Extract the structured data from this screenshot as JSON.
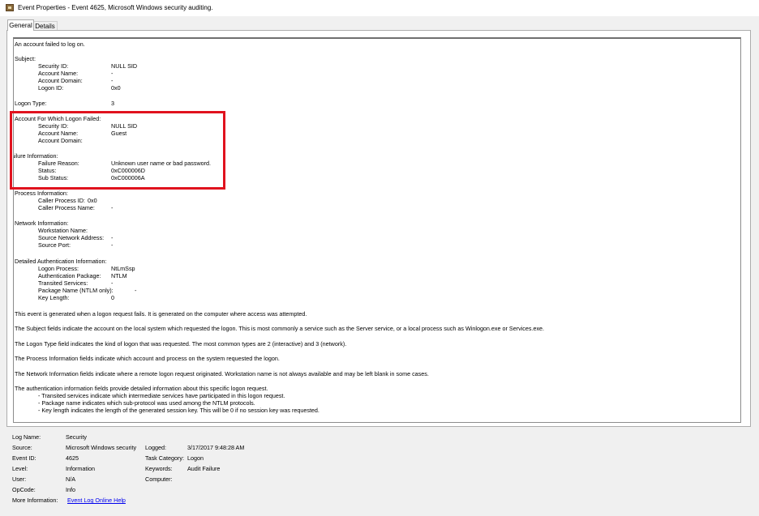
{
  "window": {
    "title": "Event Properties - Event 4625, Microsoft Windows security auditing."
  },
  "tabs": [
    {
      "label": "General"
    },
    {
      "label": "Details"
    }
  ],
  "description": {
    "intro": "An account failed to log on.",
    "subject": {
      "header": "Subject:",
      "fields": [
        {
          "label": "Security ID:",
          "value": "NULL SID"
        },
        {
          "label": "Account Name:",
          "value": "-"
        },
        {
          "label": "Account Domain:",
          "value": "-"
        },
        {
          "label": "Logon ID:",
          "value": "0x0"
        }
      ]
    },
    "logon_type": {
      "label": "Logon Type:",
      "value": "3"
    },
    "account_failed": {
      "header": "Account For Which Logon Failed:",
      "fields": [
        {
          "label": "Security ID:",
          "value": "NULL SID"
        },
        {
          "label": "Account Name:",
          "value": "Guest"
        },
        {
          "label": "Account Domain:",
          "value": ""
        }
      ]
    },
    "failure_info": {
      "header": "ailure Information:",
      "fields": [
        {
          "label": "Failure Reason:",
          "value": "Unknown user name or bad password."
        },
        {
          "label": "Status:",
          "value": "0xC000006D"
        },
        {
          "label": "Sub Status:",
          "value": "0xC000006A"
        }
      ]
    },
    "process_info": {
      "header": "Process Information:",
      "fields": [
        {
          "label": "Caller Process ID:",
          "value": "0x0"
        },
        {
          "label": "Caller Process Name:",
          "value": "-"
        }
      ]
    },
    "network_info": {
      "header": "Network Information:",
      "fields": [
        {
          "label": "Workstation Name:",
          "value": ""
        },
        {
          "label": "Source Network Address:",
          "value": "-"
        },
        {
          "label": "Source Port:",
          "value": "-"
        }
      ]
    },
    "auth_info": {
      "header": "Detailed Authentication Information:",
      "fields": [
        {
          "label": "Logon Process:",
          "value": "NtLmSsp"
        },
        {
          "label": "Authentication Package:",
          "value": "NTLM"
        },
        {
          "label": "Transited Services:",
          "value": "-"
        },
        {
          "label": "Package Name (NTLM only):",
          "value": "-"
        },
        {
          "label": "Key Length:",
          "value": "0"
        }
      ]
    },
    "paragraphs": [
      "This event is generated when a logon request fails. It is generated on the computer where access was attempted.",
      "The Subject fields indicate the account on the local system which requested the logon. This is most commonly a service such as the Server service, or a local process such as Winlogon.exe or Services.exe.",
      "The Logon Type field indicates the kind of logon that was requested. The most common types are 2 (interactive) and 3 (network).",
      "The Process Information fields indicate which account and process on the system requested the logon.",
      "The Network Information fields indicate where a remote logon request originated. Workstation name is not always available and may be left blank in some cases.",
      "The authentication information fields provide detailed information about this specific logon request."
    ],
    "bullets": [
      "- Transited services indicate which intermediate services have participated in this logon request.",
      "- Package name indicates which sub-protocol was used among the NTLM protocols.",
      "- Key length indicates the length of the generated session key. This will be 0 if no session key was requested."
    ]
  },
  "summary": {
    "log_name": {
      "label": "Log Name:",
      "value": "Security"
    },
    "source": {
      "label": "Source:",
      "value": "Microsoft Windows security"
    },
    "logged": {
      "label": "Logged:",
      "value": "3/17/2017 9:48:28 AM"
    },
    "event_id": {
      "label": "Event ID:",
      "value": "4625"
    },
    "task_category": {
      "label": "Task Category:",
      "value": "Logon"
    },
    "level": {
      "label": "Level:",
      "value": "Information"
    },
    "keywords": {
      "label": "Keywords:",
      "value": "Audit Failure"
    },
    "user": {
      "label": "User:",
      "value": "N/A"
    },
    "computer": {
      "label": "Computer:",
      "value": ""
    },
    "opcode": {
      "label": "OpCode:",
      "value": "Info"
    },
    "more_info": {
      "label": "More Information:",
      "value": "Event Log Online Help"
    }
  },
  "colors": {
    "highlight_border": "#e0121e",
    "link": "#0000ee"
  }
}
